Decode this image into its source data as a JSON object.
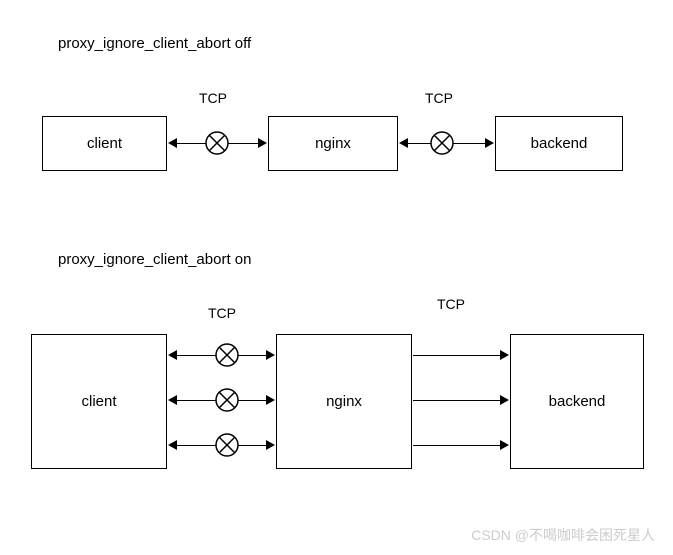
{
  "diagram1": {
    "title": "proxy_ignore_client_abort off",
    "tcp1": "TCP",
    "tcp2": "TCP",
    "client": "client",
    "nginx": "nginx",
    "backend": "backend"
  },
  "diagram2": {
    "title": "proxy_ignore_client_abort on",
    "tcp1": "TCP",
    "tcp2": "TCP",
    "client": "client",
    "nginx": "nginx",
    "backend": "backend"
  },
  "watermark": "CSDN @不喝咖啡会困死星人"
}
